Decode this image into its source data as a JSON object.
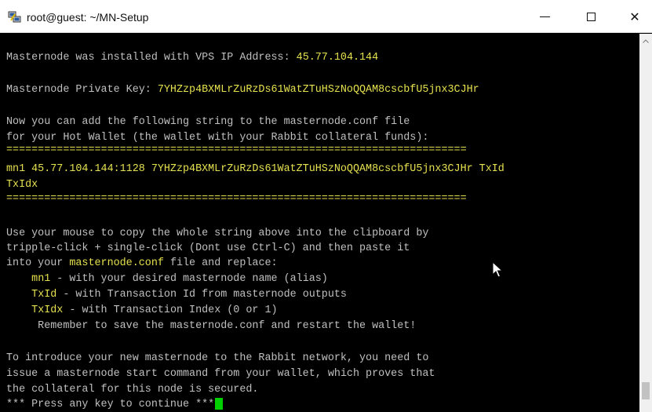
{
  "window": {
    "title": "root@guest: ~/MN-Setup",
    "app_icon": "putty-icon",
    "minimize_icon": "minimize-icon",
    "maximize_icon": "maximize-icon",
    "close_icon": "close-icon",
    "close_glyph": "✕"
  },
  "terminal": {
    "background": "#000000",
    "text_color": "#c0c0c0",
    "highlight_color": "#e5e04e",
    "cursor_color": "#00d000",
    "vps_label": "Masternode was installed with VPS IP Address: ",
    "vps_ip": "45.77.104.144",
    "pk_label": "Masternode Private Key: ",
    "private_key": "7YHZzp4BXMLrZuRzDs61WatZTuHSzNoQQAM8cscbfU5jnx3CJHr",
    "add_line_1": "Now you can add the following string to the masternode.conf file",
    "add_line_2": "for your Hot Wallet (the wallet with your Rabbit collateral funds):",
    "separator": "=========================================================================",
    "conf_line_1": "mn1 45.77.104.144:1128 7YHZzp4BXMLrZuRzDs61WatZTuHSzNoQQAM8cscbfU5jnx3CJHr TxId",
    "conf_line_2": "TxIdx",
    "copy_line_1": "Use your mouse to copy the whole string above into the clipboard by",
    "copy_line_2": "tripple-click + single-click (Dont use Ctrl-C) and then paste it",
    "copy_line_3_pre": "into your ",
    "copy_line_3_file": "masternode.conf",
    "copy_line_3_post": " file and replace:",
    "replace_items": [
      {
        "key": "mn1",
        "desc": " - with your desired masternode name (alias)"
      },
      {
        "key": "TxId",
        "desc": " - with Transaction Id from masternode outputs"
      },
      {
        "key": "TxIdx",
        "desc": " - with Transaction Index (0 or 1)"
      }
    ],
    "remember_line": "     Remember to save the masternode.conf and restart the wallet!",
    "intro_line_1": "To introduce your new masternode to the Rabbit network, you need to",
    "intro_line_2": "issue a masternode start command from your wallet, which proves that",
    "intro_line_3": "the collateral for this node is secured.",
    "prompt": "*** Press any key to continue ***"
  }
}
